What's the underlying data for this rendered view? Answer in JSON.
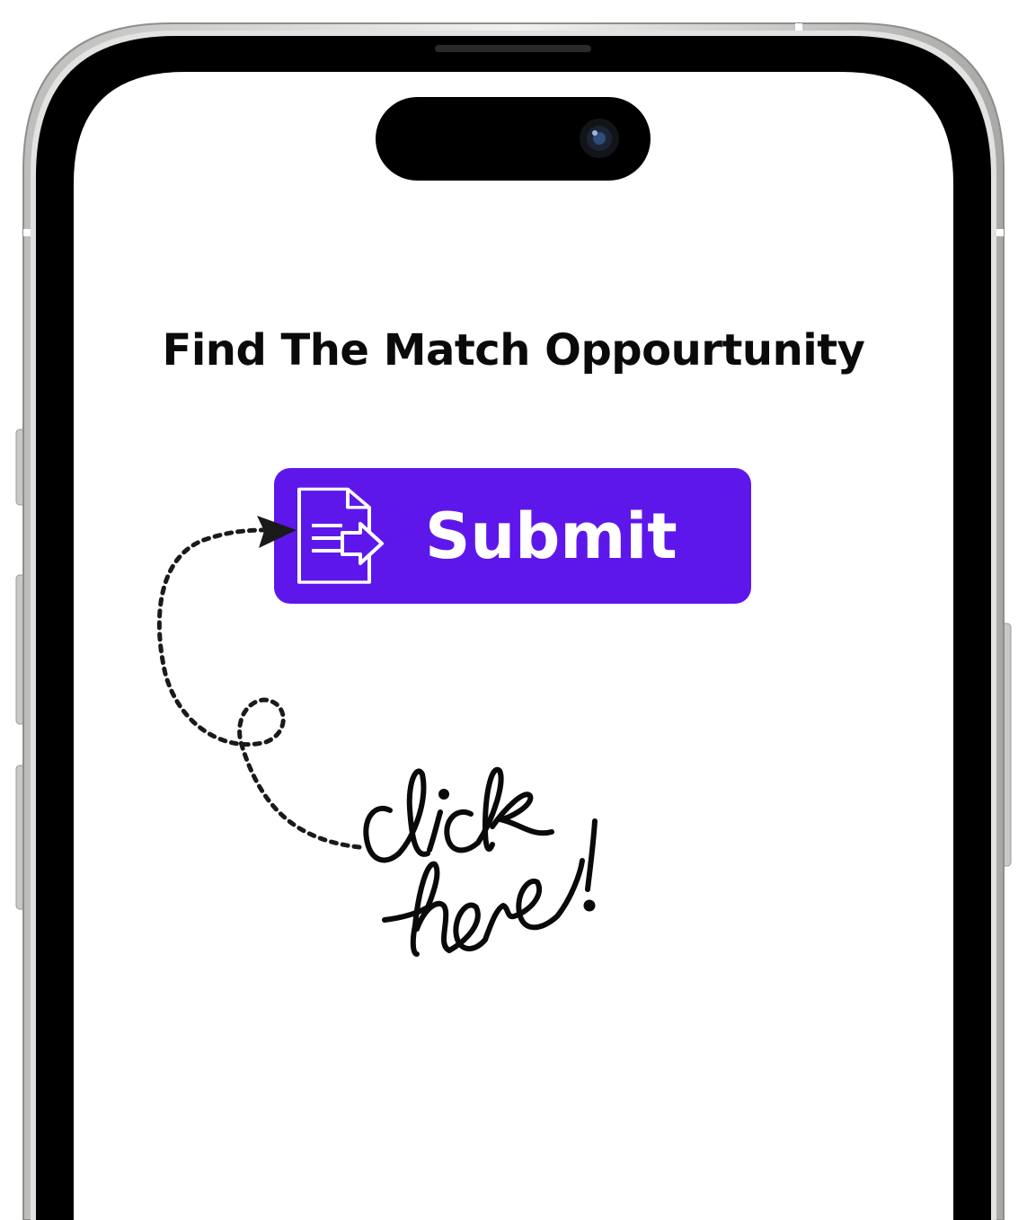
{
  "screen": {
    "title": "Find The Match Oppourtunity"
  },
  "submit_button": {
    "label": "Submit",
    "icon": "document-arrow-icon"
  },
  "annotation": {
    "handwritten_text": "click here!"
  },
  "colors": {
    "accent": "#5e17eb",
    "text": "#0a0a0a",
    "bezel": "#000000",
    "frame": "#d9d9d7"
  }
}
